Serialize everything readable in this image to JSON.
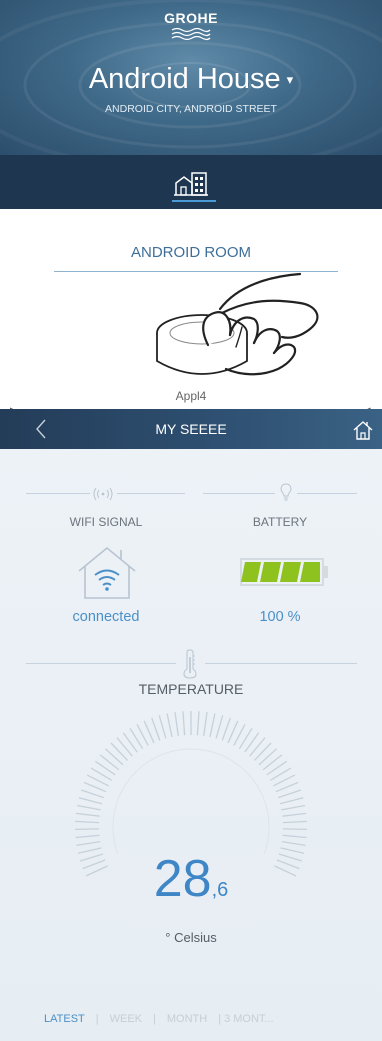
{
  "house_header": {
    "brand": "GROHE",
    "house_name": "Android House",
    "dropdown_caret": "▾",
    "address": "ANDROID CITY, ANDROID STREET",
    "tab_icon": "building-icon"
  },
  "room": {
    "name": "ANDROID ROOM",
    "device_name": "Appl4",
    "left_arrow": "▸",
    "right_arrow": "◂",
    "illustration": "hand-tapping-sensor-illustration"
  },
  "detail_header": {
    "title": "MY SEEEE",
    "back_icon": "chevron-left-icon",
    "home_icon": "home-icon"
  },
  "wifi": {
    "label": "WIFI SIGNAL",
    "status": "connected",
    "icon": "wifi-house-icon",
    "header_icon": "signal-icon"
  },
  "battery": {
    "label": "BATTERY",
    "value": "100 %",
    "level": 1.0,
    "icon": "battery-icon",
    "header_icon": "bulb-icon"
  },
  "temperature": {
    "label": "TEMPERATURE",
    "integer": "28",
    "decimal": ",6",
    "unit": "° Celsius",
    "icon": "thermometer-icon"
  },
  "period_tabs": [
    {
      "label": "LATEST",
      "active": true
    },
    {
      "label": "WEEK",
      "active": false
    },
    {
      "label": "MONTH",
      "active": false
    },
    {
      "label": "3 MONT...",
      "active": false
    }
  ],
  "colors": {
    "accent": "#4a90c8",
    "battery_green": "#8dc21f",
    "header_dark": "#1e3650"
  }
}
